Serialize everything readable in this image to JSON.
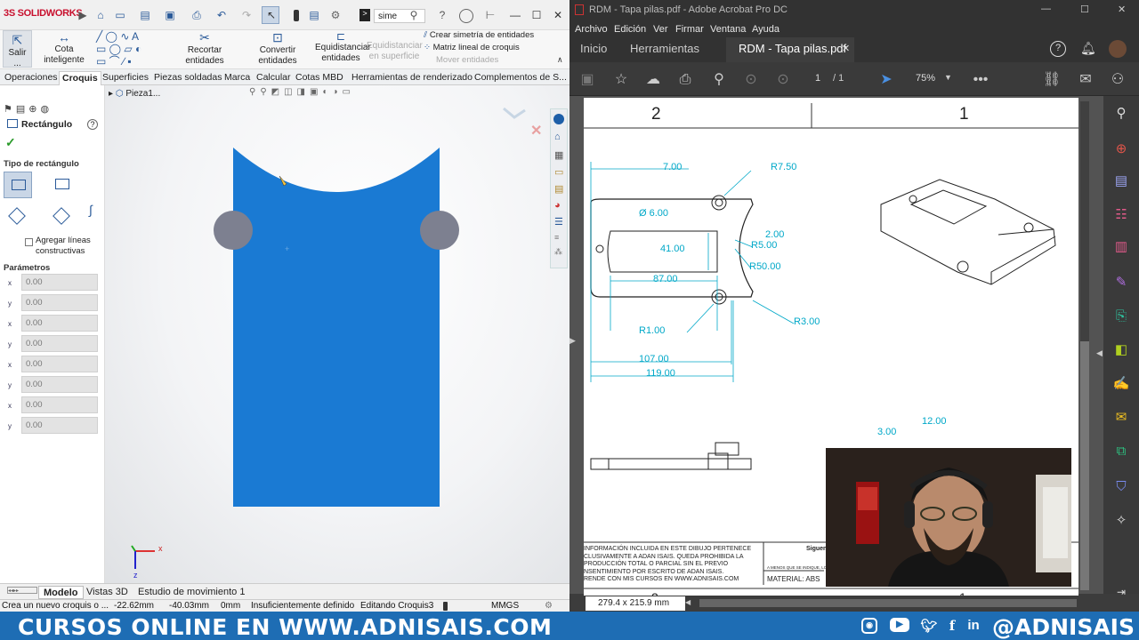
{
  "solidworks": {
    "logo": "SOLIDWORKS",
    "search_text": "sime",
    "ribbon": {
      "exit_label": "Salir ...",
      "smart_dim_label": "Cota inteligente",
      "trim_label": "Recortar entidades",
      "convert_label": "Convertir entidades",
      "offset_label_1": "Equidistanciar",
      "offset_label_2": "entidades",
      "offset_surface_1": "Equidistanciar",
      "offset_surface_2": "en superficie",
      "mirror_label": "Crear simetría de entidades",
      "linear_pattern_label": "Matriz lineal de croquis",
      "move_label": "Mover entidades"
    },
    "tabs": [
      "Operaciones",
      "Croquis",
      "Superficies",
      "Piezas soldadas",
      "Marca",
      "Calcular",
      "Cotas MBD",
      "Herramientas de renderizado",
      "Complementos de S..."
    ],
    "active_tab": "Croquis",
    "tree_part": "Pieza1...",
    "property_manager": {
      "title": "Rectángulo",
      "rect_type_label": "Tipo de rectángulo",
      "construction_label": "Agregar líneas constructivas",
      "params_label": "Parámetros",
      "params": [
        {
          "axis": "x",
          "value": "0.00"
        },
        {
          "axis": "y",
          "value": "0.00"
        },
        {
          "axis": "x",
          "value": "0.00"
        },
        {
          "axis": "y",
          "value": "0.00"
        },
        {
          "axis": "x",
          "value": "0.00"
        },
        {
          "axis": "y",
          "value": "0.00"
        },
        {
          "axis": "x",
          "value": "0.00"
        },
        {
          "axis": "y",
          "value": "0.00"
        }
      ]
    },
    "bottom_tabs": [
      "Modelo",
      "Vistas 3D",
      "Estudio de movimiento 1"
    ],
    "status": {
      "message": "Crea un nuevo croquis o ...",
      "x": "-22.62mm",
      "y": "-40.03mm",
      "z": "0mm",
      "state": "Insuficientemente definido",
      "editing": "Editando Croquis3",
      "units": "MMGS"
    },
    "triad": {
      "x": "x",
      "z": "z"
    },
    "colors": {
      "part": "#1a7ad3",
      "circle": "#7d8090"
    }
  },
  "acrobat": {
    "window_title": "RDM - Tapa pilas.pdf - Adobe Acrobat Pro DC",
    "menu": [
      "Archivo",
      "Edición",
      "Ver",
      "Firmar",
      "Ventana",
      "Ayuda"
    ],
    "tabs": [
      "Inicio",
      "Herramientas"
    ],
    "doc_tab": "RDM - Tapa pilas.pdf",
    "page_current": "1",
    "page_total": "/ 1",
    "zoom": "75%",
    "page_size": "279.4 x 215.9 mm",
    "drawing": {
      "zone_2": "2",
      "zone_1": "1",
      "dims": [
        "7.00",
        "R7.50",
        "Ø 6.00",
        "2.00",
        "41.00",
        "R5.00",
        "R50.00",
        "87.00",
        "R1.00",
        "R3.00",
        "107.00",
        "119.00",
        "12.00",
        "3.00"
      ],
      "notes": "INFORMACIÓN INCLUIDA EN ESTE DIBUJO PERTENECE\nCLUSIVAMENTE A ADAN ISAIS. QUEDA PROHIBIDA LA\nPRODUCCIÓN TOTAL O PARCIAL SIN EL PREVIO\nNSENTIMIENTO POR ESCRITO DE ADAN ISAIS.\nRENDE CON MIS CURSOS EN WWW.ADNISAIS.COM",
      "siguen": "Siguen",
      "material": "MATERIAL: ABS",
      "small_note": "A MENOS QUE SE INDIQUE, LO C"
    }
  },
  "banner": {
    "text": "CURSOS ONLINE EN WWW.ADNISAIS.COM",
    "handle": "@ADNISAIS",
    "icons": [
      "instagram-icon",
      "youtube-icon",
      "twitter-icon",
      "facebook-icon",
      "linkedin-icon"
    ]
  }
}
